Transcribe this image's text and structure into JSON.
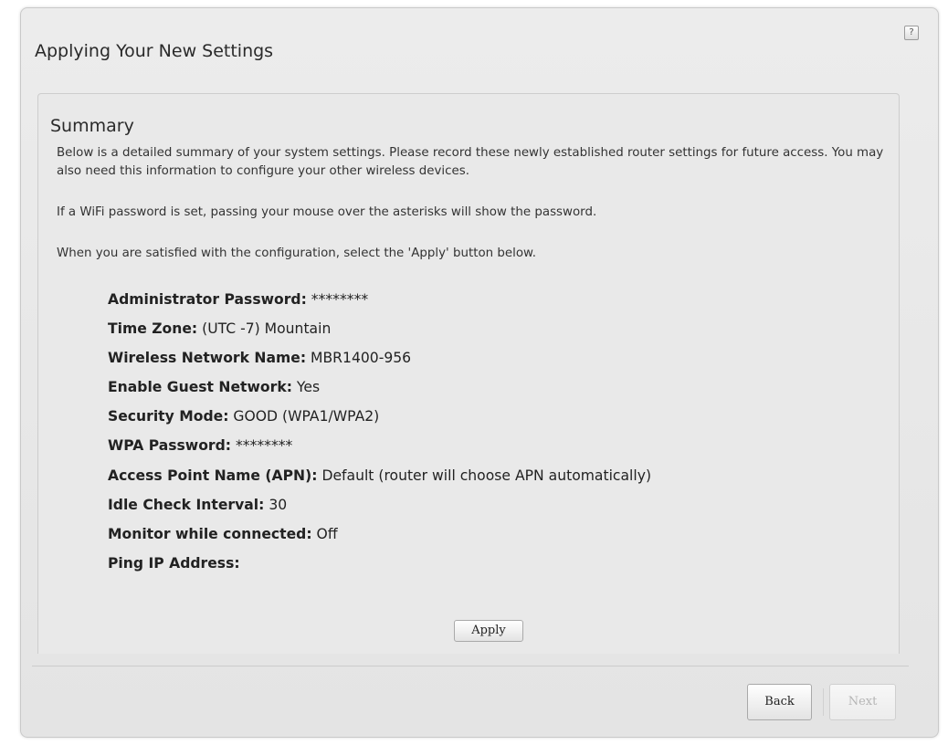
{
  "window": {
    "title": "Applying Your New Settings",
    "help_icon_glyph": "?"
  },
  "summary": {
    "title": "Summary",
    "intro": "Below is a detailed summary of your system settings. Please record these newly established router settings for future access. You may also need this information to configure your other wireless devices.",
    "wifi_note": "If a WiFi password is set, passing your mouse over the asterisks will show the password.",
    "apply_note": "When you are satisfied with the configuration, select the 'Apply' button below.",
    "settings": [
      {
        "label": "Administrator Password:",
        "value": "********"
      },
      {
        "label": "Time Zone:",
        "value": "(UTC -7) Mountain"
      },
      {
        "label": "Wireless Network Name:",
        "value": "MBR1400-956"
      },
      {
        "label": "Enable Guest Network:",
        "value": "Yes"
      },
      {
        "label": "Security Mode:",
        "value": "GOOD (WPA1/WPA2)"
      },
      {
        "label": "WPA Password:",
        "value": "********"
      },
      {
        "label": "Access Point Name (APN):",
        "value": "Default (router will choose APN automatically)"
      },
      {
        "label": "Idle Check Interval:",
        "value": "30"
      },
      {
        "label": "Monitor while connected:",
        "value": "Off"
      },
      {
        "label": "Ping IP Address:",
        "value": ""
      }
    ],
    "apply_label": "Apply"
  },
  "footer": {
    "back_label": "Back",
    "next_label": "Next",
    "next_enabled": false
  },
  "colors": {
    "window_bg": "#e6e6e6",
    "panel_bg": "#e9e9e9",
    "text": "#222222",
    "disabled_text": "#b5b5b5"
  }
}
